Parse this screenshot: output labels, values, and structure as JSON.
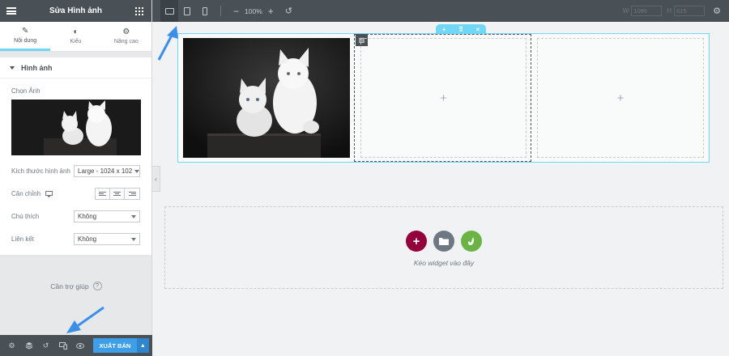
{
  "panel": {
    "title": "Sửa Hình ảnh",
    "tabs": [
      {
        "label": "Nội dung",
        "icon": "pencil-icon"
      },
      {
        "label": "Kiểu",
        "icon": "contrast-icon"
      },
      {
        "label": "Nâng cao",
        "icon": "gear-icon"
      }
    ],
    "section_title": "Hình ảnh",
    "choose_image_label": "Chọn Ảnh",
    "image_size_label": "Kích thước hình ảnh",
    "image_size_value": "Large - 1024 x 102",
    "alignment_label": "Căn chỉnh",
    "caption_label": "Chú thích",
    "caption_value": "Không",
    "link_label": "Liên kết",
    "link_value": "Không",
    "help_label": "Cần trợ giúp",
    "help_icon": "?",
    "footer": {
      "publish_label": "XUẤT BẢN",
      "publish_arrow": "▲"
    }
  },
  "topbar": {
    "zoom_minus": "−",
    "zoom_value": "100%",
    "zoom_plus": "+",
    "undo_icon": "↺",
    "width_label": "W",
    "width_placeholder": "1086",
    "height_label": "H",
    "height_placeholder": "615"
  },
  "canvas": {
    "section_handle": {
      "add": "+",
      "move": "⠿",
      "close": "×"
    },
    "empty_column_plus": "+",
    "dropzone_text": "Kéo widget vào đây",
    "dropzone_colors": {
      "add": "#93003c",
      "template": "#6d7882",
      "kit": "#6ab344"
    }
  },
  "colors": {
    "accent": "#71d7f7",
    "publish": "#3f9ee8",
    "topbar": "#495157",
    "arrow": "#3b8fe8"
  }
}
